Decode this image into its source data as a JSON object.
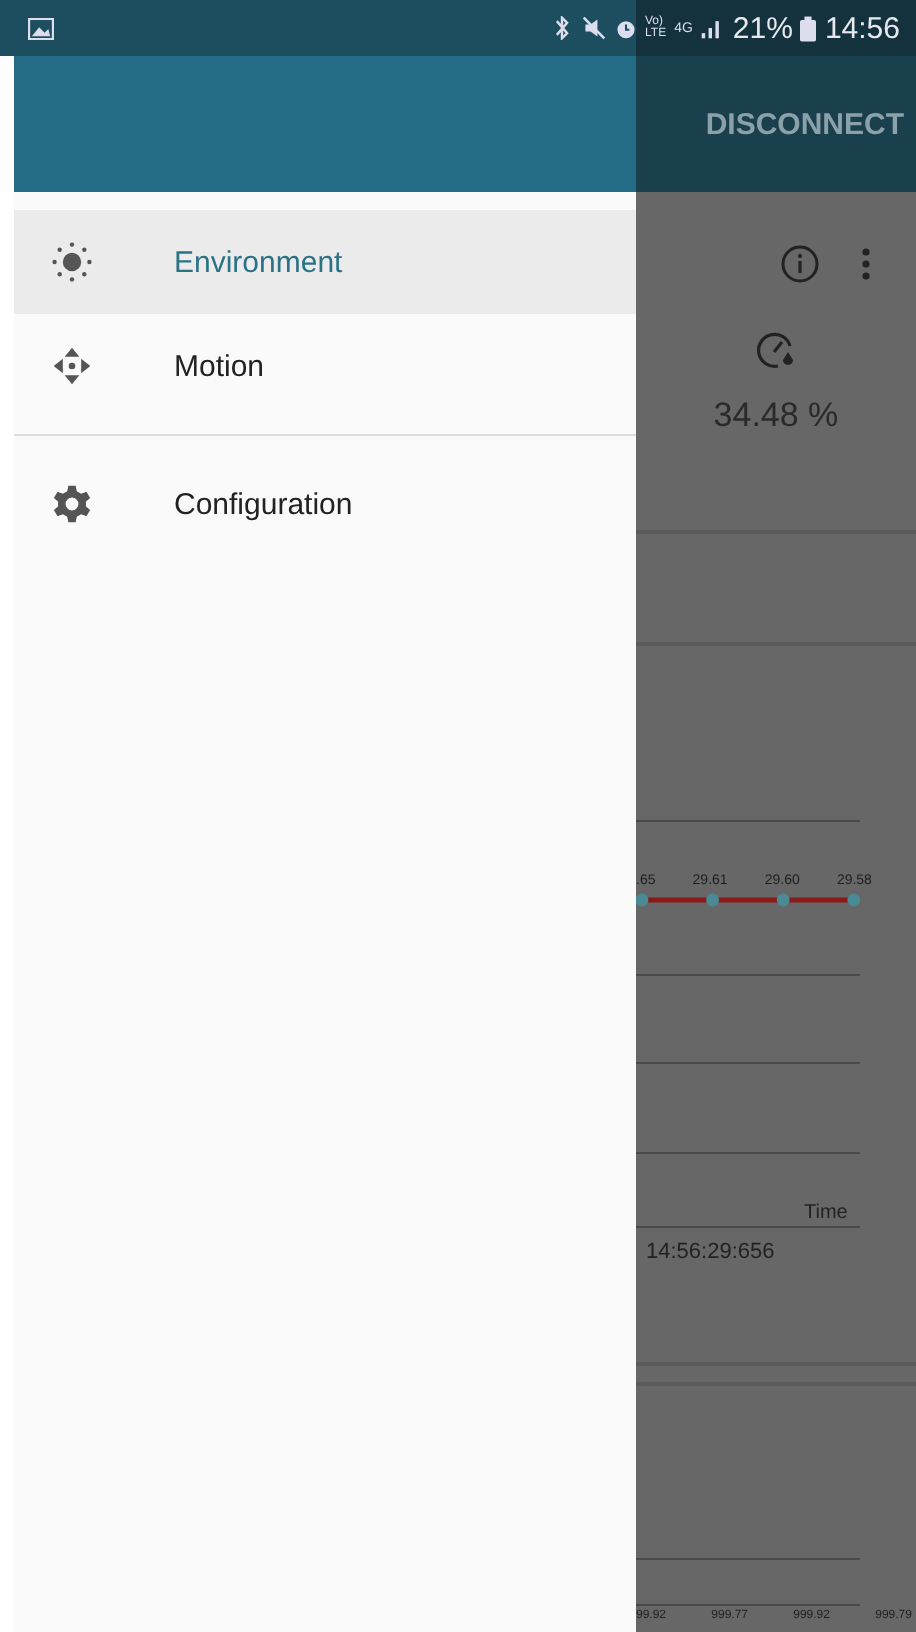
{
  "status_bar": {
    "volte_top": "Vo)",
    "volte_bottom": "LTE",
    "network": "4G",
    "battery": "21%",
    "time": "14:56"
  },
  "drawer": {
    "groups": [
      {
        "items": [
          {
            "label": "Environment",
            "selected": true
          },
          {
            "label": "Motion",
            "selected": false
          }
        ]
      },
      {
        "items": [
          {
            "label": "Configuration",
            "selected": false
          }
        ]
      }
    ]
  },
  "background": {
    "toolbar_action": "DISCONNECT",
    "humidity": "34.48 %",
    "chart_labels": [
      ".65",
      "29.61",
      "29.60",
      "29.58"
    ],
    "axis_title": "Time",
    "timestamp": "14:56:29:656",
    "second_chart_labels": [
      "99.92",
      "999.77",
      "999.92",
      "999.79"
    ]
  }
}
